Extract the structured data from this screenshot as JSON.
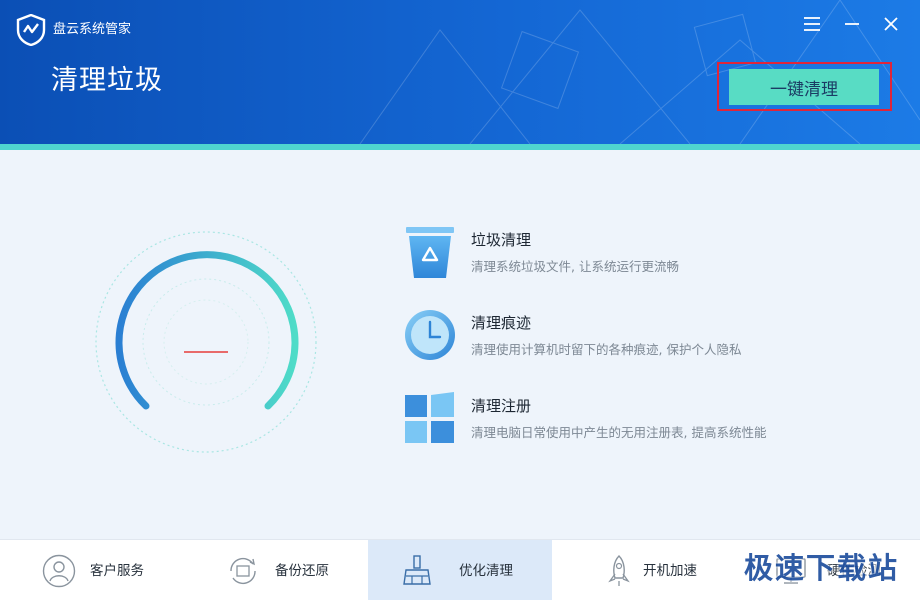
{
  "app": {
    "name": "盘云系统管家"
  },
  "header": {
    "title": "清理垃圾",
    "action_label": "一键清理"
  },
  "features": [
    {
      "title": "垃圾清理",
      "desc": "清理系统垃圾文件, 让系统运行更流畅",
      "icon": "trash-icon"
    },
    {
      "title": "清理痕迹",
      "desc": "清理使用计算机时留下的各种痕迹, 保护个人隐私",
      "icon": "clock-icon"
    },
    {
      "title": "清理注册",
      "desc": "清理电脑日常使用中产生的无用注册表, 提高系统性能",
      "icon": "registry-icon"
    }
  ],
  "bottom_nav": [
    {
      "label": "客户服务",
      "icon": "customer-service-icon",
      "active": false
    },
    {
      "label": "备份还原",
      "icon": "backup-restore-icon",
      "active": false
    },
    {
      "label": "优化清理",
      "icon": "broom-icon",
      "active": true
    },
    {
      "label": "开机加速",
      "icon": "rocket-icon",
      "active": false
    },
    {
      "label": "硬件检测",
      "icon": "hardware-icon",
      "active": false
    }
  ],
  "watermark": "极速下载站",
  "colors": {
    "header_blue": "#1467d4",
    "accent_teal": "#58dcc4",
    "highlight_red": "#e0253a"
  }
}
